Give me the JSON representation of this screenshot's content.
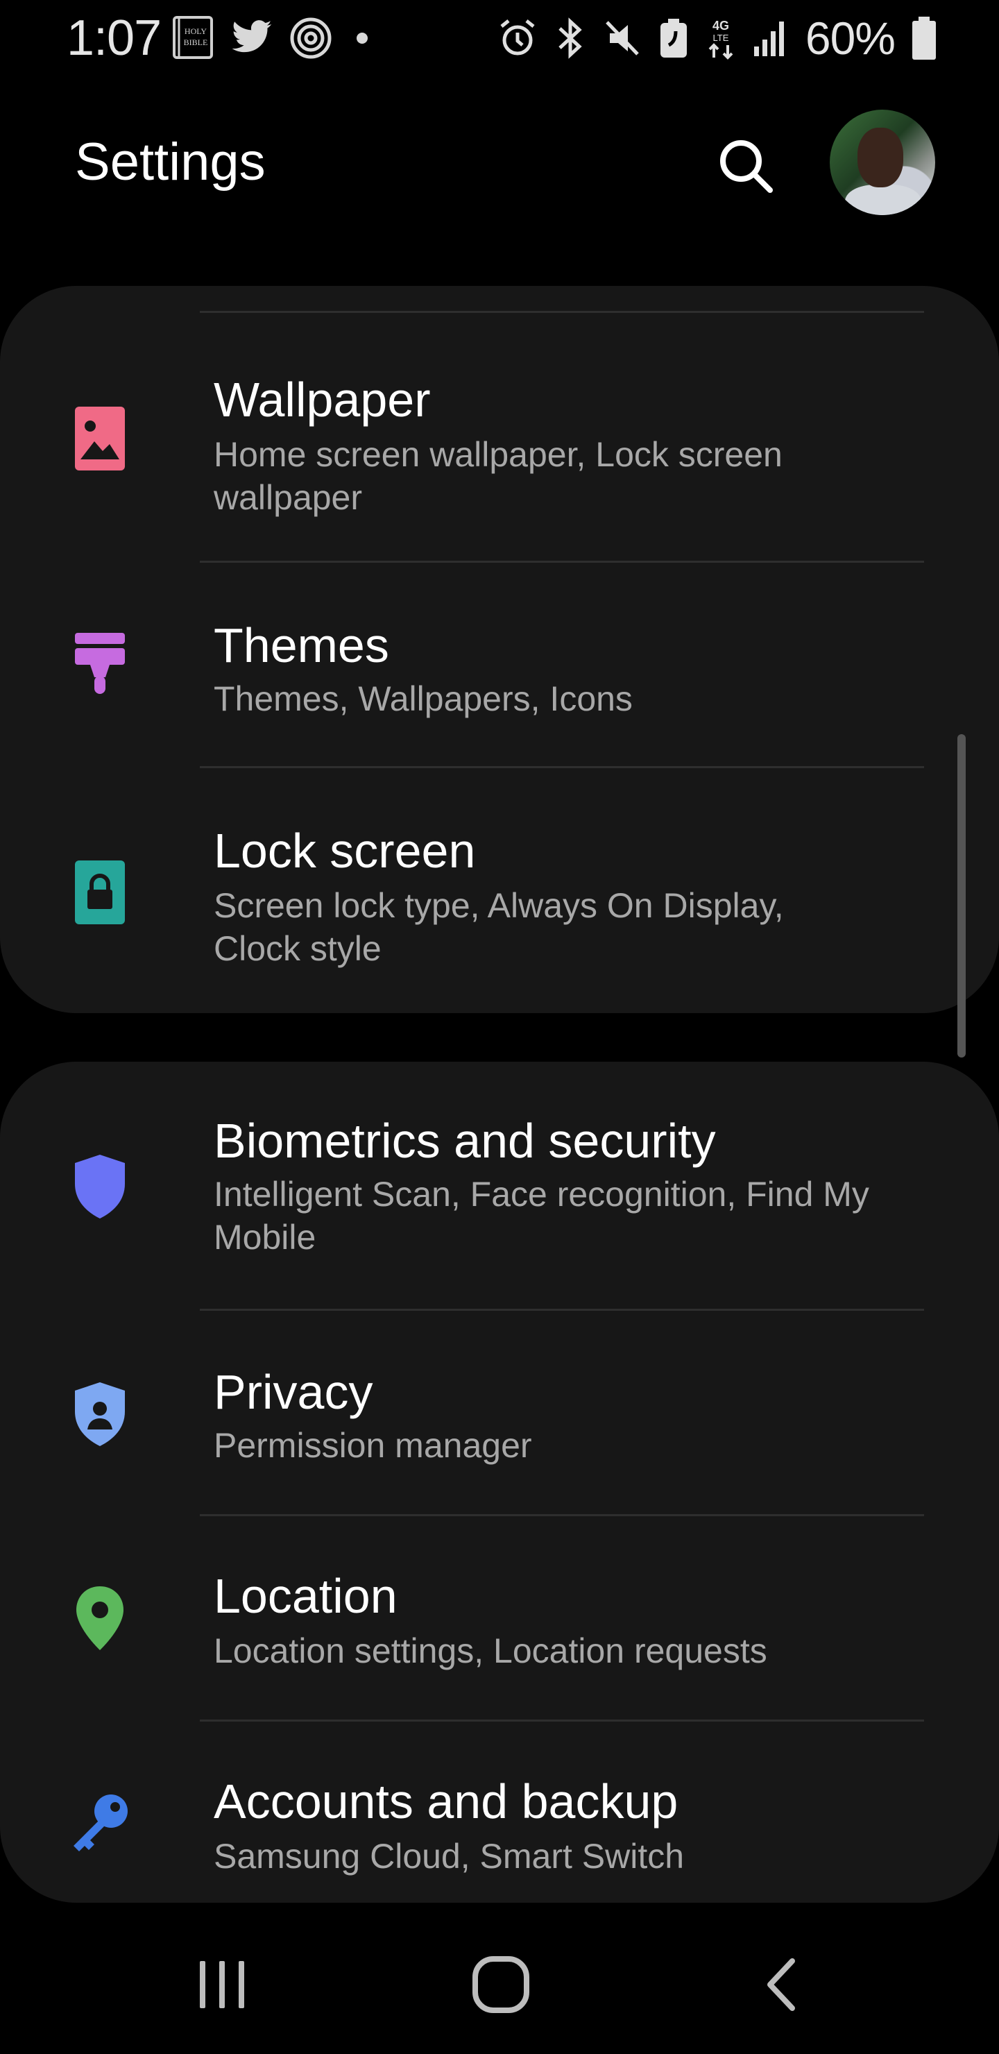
{
  "status_bar": {
    "time": "1:07",
    "left_icons": [
      "holy-bible-icon",
      "twitter-icon",
      "wireless-hotspot-icon",
      "dot-icon"
    ],
    "right_icons": [
      "alarm-icon",
      "bluetooth-icon",
      "mute-icon",
      "nfc-icon",
      "4g-lte-icon",
      "signal-icon"
    ],
    "battery_percent": "60%",
    "bible_label_1": "HOLY",
    "bible_label_2": "BIBLE",
    "lte_label_1": "4G",
    "lte_label_2": "LTE"
  },
  "header": {
    "title": "Settings",
    "search_icon": "search-icon",
    "avatar": "profile-avatar"
  },
  "groups": [
    {
      "items": [
        {
          "title": "Wallpaper",
          "subtitle": "Home screen wallpaper, Lock screen wallpaper",
          "icon": "wallpaper-icon",
          "color": "#f06a86"
        },
        {
          "title": "Themes",
          "subtitle": "Themes, Wallpapers, Icons",
          "icon": "themes-brush-icon",
          "color": "#c66be0"
        },
        {
          "title": "Lock screen",
          "subtitle": "Screen lock type, Always On Display, Clock style",
          "icon": "lock-icon",
          "color": "#26a69a"
        }
      ]
    },
    {
      "items": [
        {
          "title": "Biometrics and security",
          "subtitle": "Intelligent Scan, Face recognition, Find My Mobile",
          "icon": "shield-icon",
          "color": "#6a73f5"
        },
        {
          "title": "Privacy",
          "subtitle": "Permission manager",
          "icon": "privacy-shield-icon",
          "color": "#7ea8f2"
        },
        {
          "title": "Location",
          "subtitle": "Location settings, Location requests",
          "icon": "location-pin-icon",
          "color": "#5cb85c"
        },
        {
          "title": "Accounts and backup",
          "subtitle": "Samsung Cloud, Smart Switch",
          "icon": "key-icon",
          "color": "#3f7be6"
        }
      ]
    }
  ],
  "nav_bar": {
    "recents": "recents-icon",
    "home": "home-icon",
    "back": "back-icon"
  }
}
